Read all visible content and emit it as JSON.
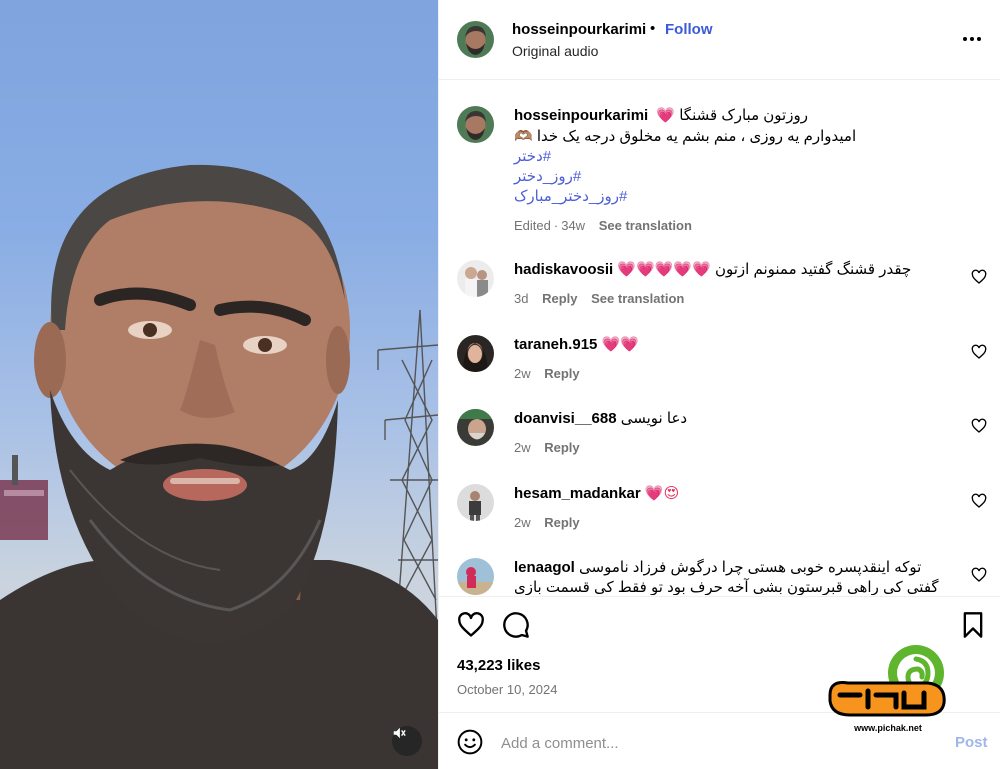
{
  "post": {
    "username": "hosseinpourkarimi",
    "follow_label": "Follow",
    "separator": "•",
    "audio": "Original audio",
    "more_icon": "more-horizontal-icon"
  },
  "caption": {
    "username": "hosseinpourkarimi",
    "line1": "روزتون مبارک قشنگا 💗",
    "line2": "امیدوارم یه روزی ، منم بشم یه مخلوق درجه یک خدا 🫶🏽",
    "tags": [
      "#دختر",
      "#روز_دختر",
      "#روز_دختر_مبارک"
    ],
    "edited": "Edited",
    "age": "34w",
    "see_translation": "See translation"
  },
  "comments": [
    {
      "username": "hadiskavoosii",
      "text": "چقدر قشنگ گفتید ممنونم ازتون 💗💗💗💗💗",
      "age": "3d",
      "reply": "Reply",
      "see_translation": "See translation"
    },
    {
      "username": "taraneh.915",
      "text": "💗💗",
      "age": "2w",
      "reply": "Reply"
    },
    {
      "username": "doanvisi__688",
      "text": "دعا نویسی",
      "age": "2w",
      "reply": "Reply"
    },
    {
      "username": "hesam_madankar",
      "text": "💗😍",
      "age": "2w",
      "reply": "Reply"
    },
    {
      "username": "lenaagol",
      "text": "توکه اینقدپسره خوبی هستی چرا درگوش فرزاد ناموسی گفتی کی راهی قبرستون بشی آخه حرف بود تو فقط کی قسمت بازی",
      "age": "",
      "reply": ""
    }
  ],
  "actions": {
    "like_icon": "heart-outline-icon",
    "comment_icon": "comment-icon",
    "save_icon": "bookmark-icon",
    "likes": "43,223 likes",
    "date": "October 10, 2024"
  },
  "add_comment": {
    "placeholder": "Add a comment...",
    "post_label": "Post",
    "emoji_icon": "smiley-icon"
  },
  "media": {
    "mute_icon": "speaker-muted-icon"
  },
  "watermark": {
    "url": "www.pichak.net"
  },
  "colors": {
    "follow": "#3b5ad8",
    "hashtag": "#4c5ed8",
    "muted_text": "#737373",
    "post_disabled": "#9fb6ea",
    "heart": "#e82b57"
  }
}
